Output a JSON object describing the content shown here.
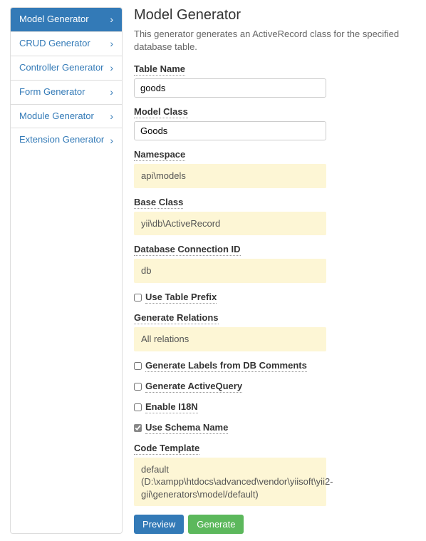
{
  "sidebar": {
    "items": [
      {
        "label": "Model Generator",
        "active": true
      },
      {
        "label": "CRUD Generator",
        "active": false
      },
      {
        "label": "Controller Generator",
        "active": false
      },
      {
        "label": "Form Generator",
        "active": false
      },
      {
        "label": "Module Generator",
        "active": false
      },
      {
        "label": "Extension Generator",
        "active": false
      }
    ]
  },
  "page": {
    "title": "Model Generator",
    "lead": "This generator generates an ActiveRecord class for the specified database table."
  },
  "form": {
    "table_name": {
      "label": "Table Name",
      "value": "goods"
    },
    "model_class": {
      "label": "Model Class",
      "value": "Goods"
    },
    "namespace": {
      "label": "Namespace",
      "value": "api\\models"
    },
    "base_class": {
      "label": "Base Class",
      "value": "yii\\db\\ActiveRecord"
    },
    "db_conn": {
      "label": "Database Connection ID",
      "value": "db"
    },
    "use_table_prefix": {
      "label": "Use Table Prefix",
      "checked": false
    },
    "generate_relations": {
      "label": "Generate Relations",
      "value": "All relations"
    },
    "generate_labels": {
      "label": "Generate Labels from DB Comments",
      "checked": false
    },
    "generate_activequery": {
      "label": "Generate ActiveQuery",
      "checked": false
    },
    "enable_i18n": {
      "label": "Enable I18N",
      "checked": false
    },
    "use_schema_name": {
      "label": "Use Schema Name",
      "checked": true
    },
    "code_template": {
      "label": "Code Template",
      "value": "default (D:\\xampp\\htdocs\\advanced\\vendor\\yiisoft\\yii2-gii\\generators\\model/default)"
    }
  },
  "buttons": {
    "preview": "Preview",
    "generate": "Generate"
  }
}
